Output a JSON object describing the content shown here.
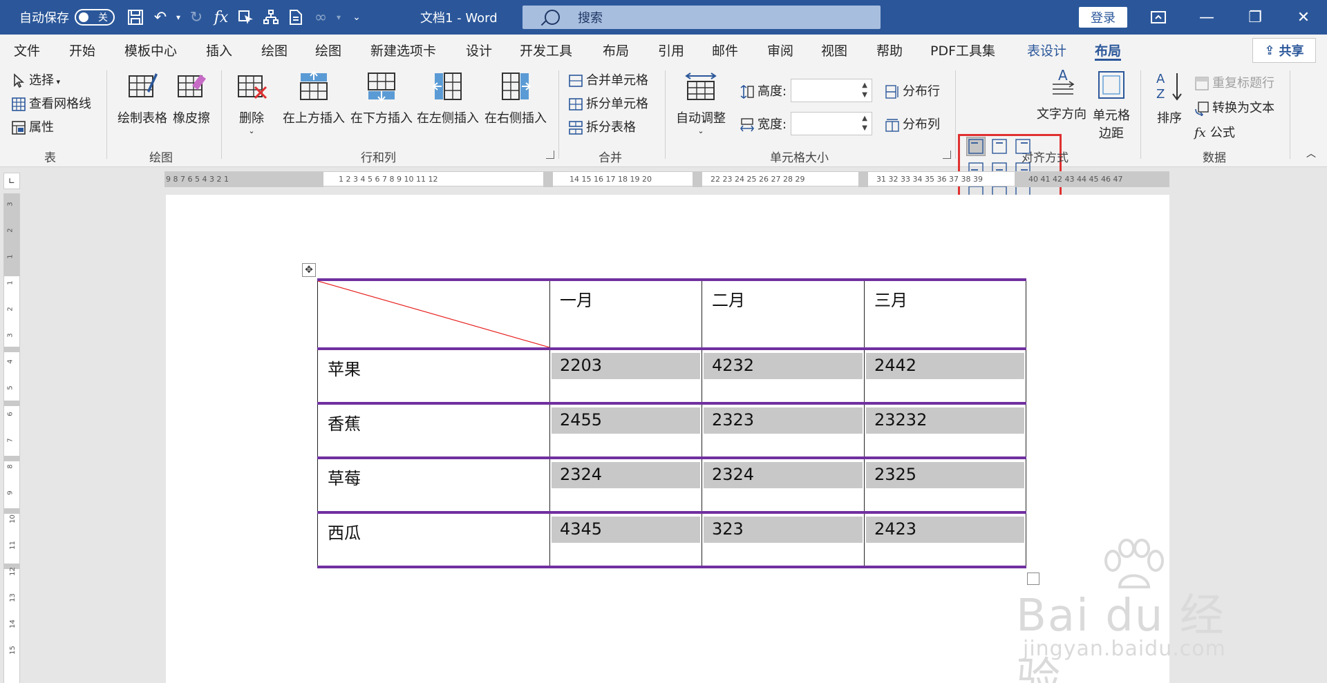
{
  "titlebar": {
    "autosave_label": "自动保存",
    "autosave_state": "关",
    "doc_title": "文档1  -  Word",
    "search_placeholder": "搜索",
    "login_label": "登录"
  },
  "tabs": [
    {
      "label": "文件"
    },
    {
      "label": "开始"
    },
    {
      "label": "模板中心"
    },
    {
      "label": "插入"
    },
    {
      "label": "绘图"
    },
    {
      "label": "绘图"
    },
    {
      "label": "新建选项卡"
    },
    {
      "label": "设计"
    },
    {
      "label": "开发工具"
    },
    {
      "label": "布局"
    },
    {
      "label": "引用"
    },
    {
      "label": "邮件"
    },
    {
      "label": "审阅"
    },
    {
      "label": "视图"
    },
    {
      "label": "帮助"
    },
    {
      "label": "PDF工具集"
    },
    {
      "label": "表设计"
    },
    {
      "label": "布局"
    }
  ],
  "share_label": "共享",
  "ribbon": {
    "table_group": {
      "select_label": "选择",
      "gridlines_label": "查看网格线",
      "properties_label": "属性",
      "group_label": "表"
    },
    "draw_group": {
      "draw_table_label": "绘制表格",
      "eraser_label": "橡皮擦",
      "group_label": "绘图"
    },
    "rows_cols_group": {
      "delete_label": "删除",
      "insert_above_label": "在上方插入",
      "insert_below_label": "在下方插入",
      "insert_left_label": "在左侧插入",
      "insert_right_label": "在右侧插入",
      "group_label": "行和列"
    },
    "merge_group": {
      "merge_cells_label": "合并单元格",
      "split_cells_label": "拆分单元格",
      "split_table_label": "拆分表格",
      "group_label": "合并"
    },
    "cell_size_group": {
      "autofit_label": "自动调整",
      "height_label": "高度:",
      "width_label": "宽度:",
      "distribute_rows_label": "分布行",
      "distribute_cols_label": "分布列",
      "group_label": "单元格大小"
    },
    "alignment_group": {
      "text_direction_label": "文字方向",
      "cell_margins_label_1": "单元格",
      "cell_margins_label_2": "边距",
      "group_label": "对齐方式"
    },
    "data_group": {
      "sort_label": "排序",
      "repeat_header_label": "重复标题行",
      "convert_text_label": "转换为文本",
      "formula_label": "公式",
      "group_label": "数据"
    }
  },
  "ruler": {
    "left_ticks": "9  8  7  6  5  4  3  2  1",
    "main_ticks": "1  2  3  4  5  6  7  8  9  10  11  12",
    "mid_ticks_1": "14  15  16  17  18  19  20",
    "mid_ticks_2": "22  23  24  25  26  27  28  29",
    "mid_ticks_3": "31  32  33  34  35  36  37  38  39",
    "right_ticks": "40  41  42  43  44  45  46  47"
  },
  "table": {
    "headers": [
      "",
      "一月",
      "二月",
      "三月"
    ],
    "rows": [
      {
        "name": "苹果",
        "values": [
          "2203",
          "4232",
          "2442"
        ]
      },
      {
        "name": "香蕉",
        "values": [
          "2455",
          "2323",
          "23232"
        ]
      },
      {
        "name": "草莓",
        "values": [
          "2324",
          "2324",
          "2325"
        ]
      },
      {
        "name": "西瓜",
        "values": [
          "4345",
          "323",
          "2423"
        ]
      }
    ]
  },
  "watermark": {
    "main": "Bai du 经验",
    "sub": "jingyan.baidu.com"
  },
  "colors": {
    "title_blue": "#2b579a",
    "table_border_purple": "#7030a0",
    "cell_shading_gray": "#c8c8c8",
    "highlight_red": "#e03030"
  }
}
